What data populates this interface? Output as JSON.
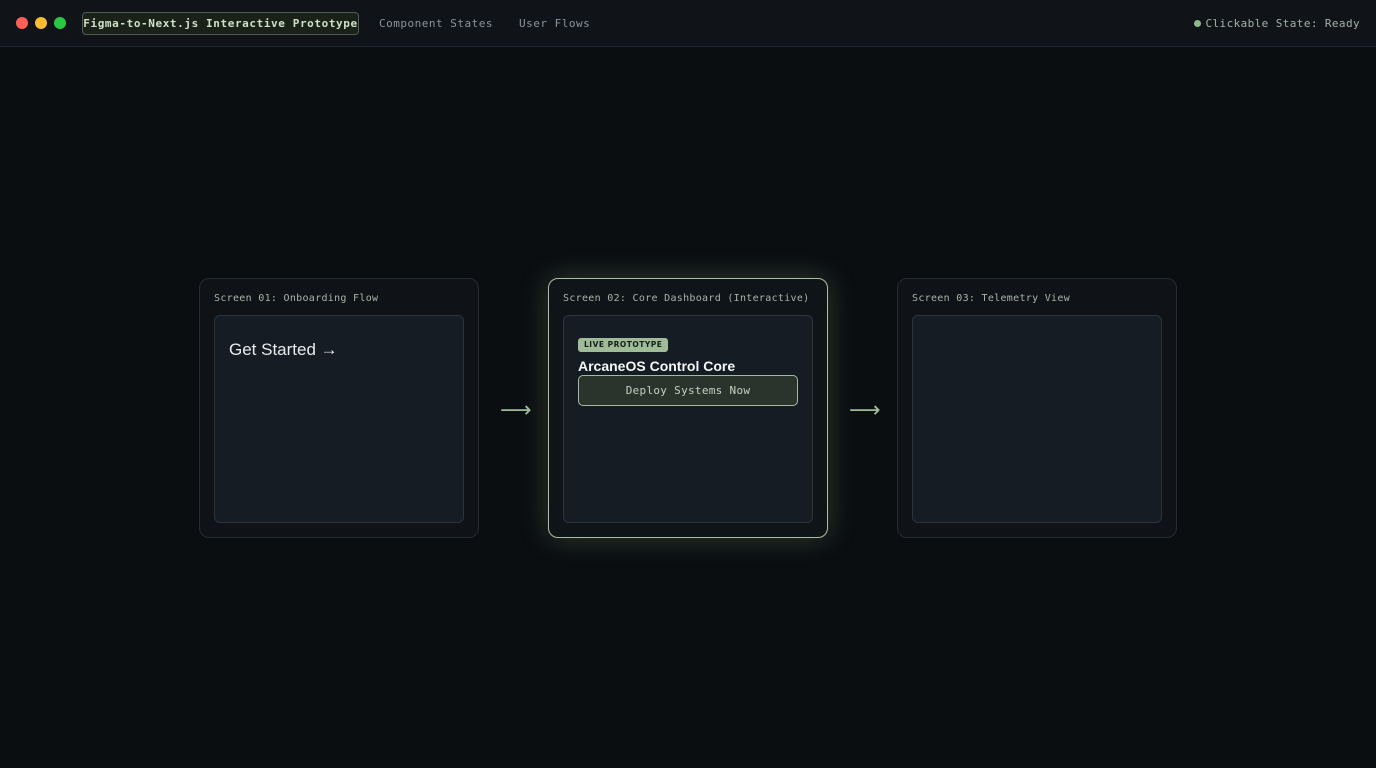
{
  "window": {
    "controls": [
      "close",
      "minimize",
      "maximize"
    ],
    "colors": {
      "close": "#ff5f57",
      "minimize": "#febc2e",
      "maximize": "#28c840"
    }
  },
  "tabs": [
    {
      "label": "Figma-to-Next.js Interactive Prototype",
      "active": true
    },
    {
      "label": "Component States",
      "active": false
    },
    {
      "label": "User Flows",
      "active": false
    }
  ],
  "status": {
    "text": "Clickable State: Ready",
    "color": "#8fb88a"
  },
  "screens": [
    {
      "label": "Screen 01: Onboarding Flow",
      "cta": "Get Started →"
    },
    {
      "label": "Screen 02: Core Dashboard (Interactive)",
      "badge": "LIVE PROTOTYPE",
      "title": "ArcaneOS Control Core",
      "button": "Deploy Systems Now",
      "highlighted": true
    },
    {
      "label": "Screen 03: Telemetry View"
    }
  ],
  "flow": {
    "arrow_1": "⟶",
    "arrow_2": "⟶"
  },
  "accent": "#9fbb98"
}
